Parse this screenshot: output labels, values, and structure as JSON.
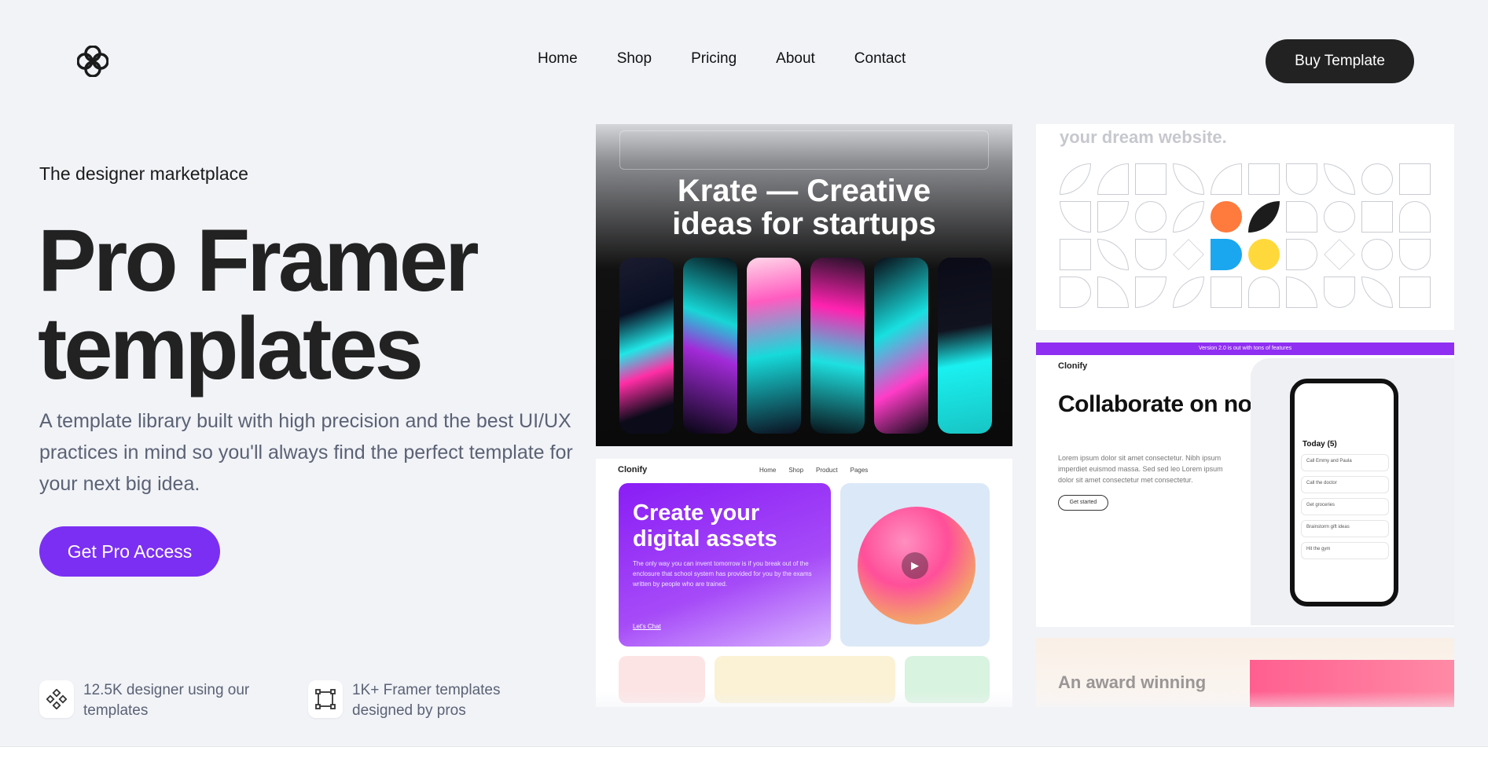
{
  "nav": {
    "items": [
      "Home",
      "Shop",
      "Pricing",
      "About",
      "Contact"
    ],
    "buy_label": "Buy Template"
  },
  "hero": {
    "eyebrow": "The designer marketplace",
    "title_line1": "Pro Framer",
    "title_line2": "templates",
    "description": "A template library built with high precision and the best UI/UX practices in mind so you'll always find the perfect template for your next big idea.",
    "cta_label": "Get Pro Access"
  },
  "stats": [
    {
      "icon": "nodes-icon",
      "text": "12.5K designer using our templates"
    },
    {
      "icon": "frame-icon",
      "text": "1K+ Framer templates designed by pros"
    }
  ],
  "showcase": {
    "krate": {
      "title_line1": "Krate — Creative",
      "title_line2": "ideas for startups"
    },
    "shapes": {
      "text": "your dream website."
    },
    "clonify_assets": {
      "brand": "Clonify",
      "links": [
        "Home",
        "Shop",
        "Product",
        "Pages"
      ],
      "title": "Create your digital assets",
      "body": "The only way you can invent tomorrow is if you break out of the enclosure that school system has provided for you by the exams written by people who are trained.",
      "link": "Let's Chat"
    },
    "clonify_notes": {
      "banner": "Version 2.0 is out with tons of features",
      "brand": "Clonify",
      "title": "Collaborate on note taking.",
      "body": "Lorem ipsum dolor sit amet consectetur. Nibh ipsum imperdiet euismod massa. Sed sed leo Lorem ipsum dolor sit amet consectetur met consectetur.",
      "cta": "Get started",
      "today": "Today (5)",
      "tasks": [
        "Call Emmy and Paula",
        "Call the doctor",
        "Get groceries",
        "Brainstorm gift ideas",
        "Hit the gym"
      ]
    },
    "award": {
      "title": "An award winning"
    }
  },
  "colors": {
    "accent": "#7b2ff2",
    "dark": "#222222",
    "bg": "#f1f3f7"
  }
}
